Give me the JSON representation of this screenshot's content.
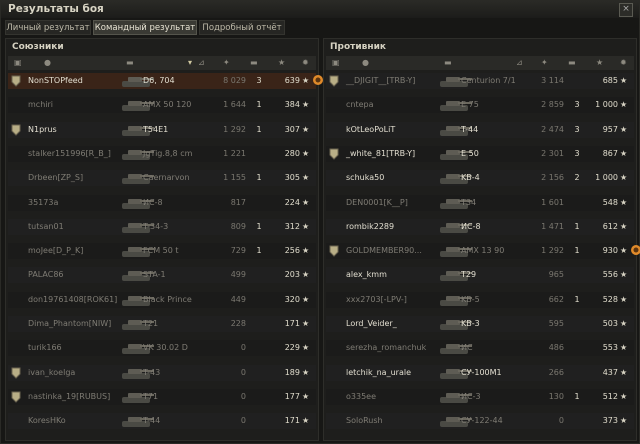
{
  "window": {
    "title": "Результаты боя",
    "close_symbol": "×"
  },
  "tabs": [
    {
      "label": "Личный результат",
      "active": false
    },
    {
      "label": "Командный результат",
      "active": true
    },
    {
      "label": "Подробный отчёт",
      "active": false
    }
  ],
  "allies": {
    "title": "Союзники",
    "rows": [
      {
        "player": "NonSTOPfeed",
        "tank": "D6, 704",
        "damage": "8 029",
        "frags": "3",
        "xp": "639",
        "you": true,
        "alive": true,
        "medal": true,
        "achievement": true
      },
      {
        "player": "mchiri",
        "tank": "AMX 50 120",
        "damage": "1 644",
        "frags": "1",
        "xp": "384",
        "alive": false
      },
      {
        "player": "N1prus",
        "tank": "T54E1",
        "damage": "1 292",
        "frags": "1",
        "xp": "307",
        "alive": true,
        "medal": true
      },
      {
        "player": "stalker151996[R_B_]",
        "tank": "JgTig.8,8 cm",
        "damage": "1 221",
        "frags": "",
        "xp": "280",
        "alive": false
      },
      {
        "player": "Drbeen[ZP_S]",
        "tank": "Caernarvon",
        "damage": "1 155",
        "frags": "1",
        "xp": "305",
        "alive": false
      },
      {
        "player": "35173a",
        "tank": "ИС-8",
        "damage": "817",
        "frags": "",
        "xp": "224",
        "alive": false
      },
      {
        "player": "tutsan01",
        "tank": "T-34-3",
        "damage": "809",
        "frags": "1",
        "xp": "312",
        "alive": false
      },
      {
        "player": "moJee[D_P_K]",
        "tank": "FCM 50 t",
        "damage": "729",
        "frags": "1",
        "xp": "256",
        "alive": false
      },
      {
        "player": "PALAC86",
        "tank": "STA-1",
        "damage": "499",
        "frags": "",
        "xp": "203",
        "alive": false
      },
      {
        "player": "don19761408[ROK61]",
        "tank": "Black Prince",
        "damage": "449",
        "frags": "",
        "xp": "320",
        "alive": false
      },
      {
        "player": "Dima_Phantom[NIW]",
        "tank": "T21",
        "damage": "228",
        "frags": "",
        "xp": "171",
        "alive": false
      },
      {
        "player": "turik166",
        "tank": "VK 30.02 D",
        "damage": "0",
        "frags": "",
        "xp": "229",
        "alive": false
      },
      {
        "player": "ivan_koelga",
        "tank": "T-43",
        "damage": "0",
        "frags": "",
        "xp": "189",
        "alive": false,
        "medal": true
      },
      {
        "player": "nastinka_19[RUBUS]",
        "tank": "T71",
        "damage": "0",
        "frags": "",
        "xp": "177",
        "alive": false,
        "medal": true
      },
      {
        "player": "KoresHKo",
        "tank": "T-44",
        "damage": "0",
        "frags": "",
        "xp": "171",
        "alive": false
      }
    ]
  },
  "enemies": {
    "title": "Противник",
    "rows": [
      {
        "player": "__DJIGIT__[TRB-Y]",
        "tank": "Centurion 7/1",
        "damage": "3 114",
        "frags": "",
        "xp": "685",
        "alive": false,
        "medal": true
      },
      {
        "player": "cntepa",
        "tank": "E 75",
        "damage": "2 859",
        "frags": "3",
        "xp": "1 000",
        "alive": false
      },
      {
        "player": "kOtLeoPoLiT",
        "tank": "T-44",
        "damage": "2 474",
        "frags": "3",
        "xp": "957",
        "alive": true
      },
      {
        "player": "_white_81[TRB-Y]",
        "tank": "E 50",
        "damage": "2 301",
        "frags": "3",
        "xp": "867",
        "alive": true,
        "medal": true
      },
      {
        "player": "schuka50",
        "tank": "KB-4",
        "damage": "2 156",
        "frags": "2",
        "xp": "1 000",
        "alive": true
      },
      {
        "player": "DEN0001[K__P]",
        "tank": "T34",
        "damage": "1 601",
        "frags": "",
        "xp": "548",
        "alive": false
      },
      {
        "player": "rombik2289",
        "tank": "ИС-8",
        "damage": "1 471",
        "frags": "1",
        "xp": "612",
        "alive": true
      },
      {
        "player": "GOLDMEMBER90...",
        "tank": "AMX 13 90",
        "damage": "1 292",
        "frags": "1",
        "xp": "930",
        "alive": false,
        "medal": true,
        "achievement": true
      },
      {
        "player": "alex_kmm",
        "tank": "T29",
        "damage": "965",
        "frags": "",
        "xp": "556",
        "alive": true
      },
      {
        "player": "xxx2703[-LPV-]",
        "tank": "KB-5",
        "damage": "662",
        "frags": "1",
        "xp": "528",
        "alive": false
      },
      {
        "player": "Lord_Veider_",
        "tank": "KB-3",
        "damage": "595",
        "frags": "",
        "xp": "503",
        "alive": true
      },
      {
        "player": "serezha_romanchuk",
        "tank": "ИС",
        "damage": "486",
        "frags": "",
        "xp": "553",
        "alive": false
      },
      {
        "player": "letchik_na_urale",
        "tank": "СУ-100М1",
        "damage": "266",
        "frags": "",
        "xp": "437",
        "alive": true
      },
      {
        "player": "o335ee",
        "tank": "ИС-3",
        "damage": "130",
        "frags": "1",
        "xp": "512",
        "alive": false
      },
      {
        "player": "SoloRush",
        "tank": "СУ-122-44",
        "damage": "0",
        "frags": "",
        "xp": "373",
        "alive": false
      }
    ]
  },
  "colors": {
    "you_row": "#3a2418",
    "alive_text": "#e2ded0",
    "dead_text": "#7f7c74",
    "achievement": "#e08a2a"
  }
}
